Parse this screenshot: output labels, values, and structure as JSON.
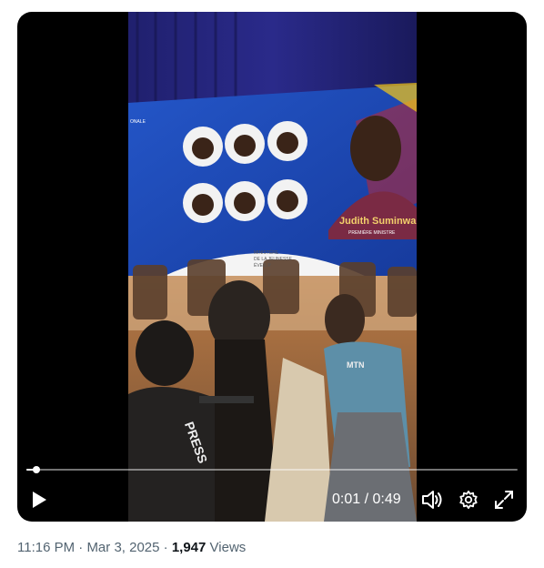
{
  "video": {
    "screen": {
      "name": "Judith Suminwa",
      "role": "PREMIÈRE MINISTRE",
      "ministry_line1": "MINISTÈRE",
      "ministry_line2": "DE LA JEUNESSE",
      "ministry_line3": "ÉVEIL P",
      "edge_text": "ONALE"
    },
    "vest_press": "PRESS",
    "vest_brand": "MTN"
  },
  "player": {
    "current_time": "0:01",
    "separator": "/",
    "duration": "0:49",
    "progress": 0.02
  },
  "post_meta": {
    "time": "11:16 PM",
    "dot1": "·",
    "date": "Mar 3, 2025",
    "dot2": "·",
    "views_count": "1,947",
    "views_label": "Views"
  },
  "colors": {
    "player_bg": "#000000",
    "screen_blue": "#1d3fa8",
    "meta_gray": "#536471",
    "meta_dark": "#0f1419"
  }
}
